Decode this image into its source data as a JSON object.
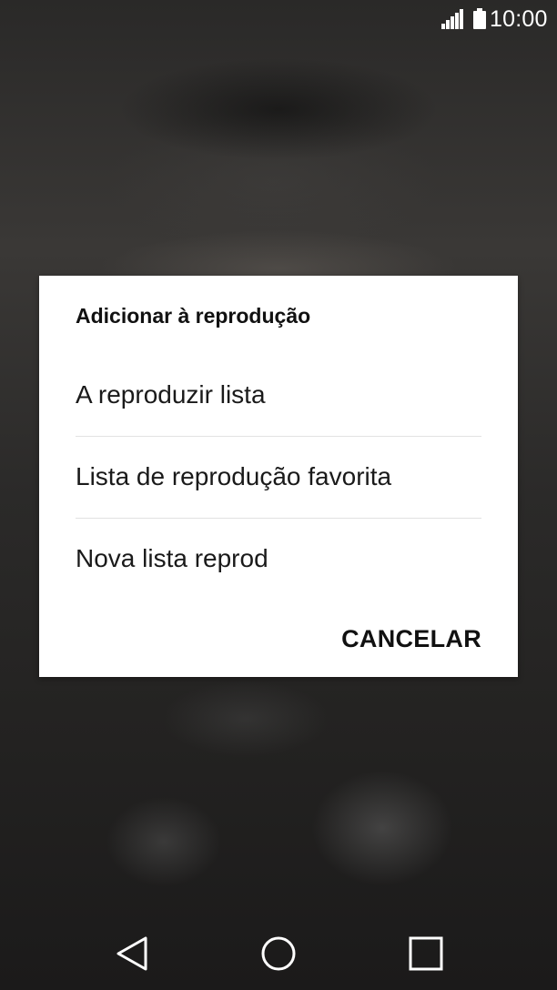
{
  "status_bar": {
    "time": "10:00",
    "signal_icon": "signal-icon",
    "battery_icon": "battery-icon"
  },
  "dialog": {
    "title": "Adicionar à reprodução",
    "options": [
      {
        "label": "A reproduzir lista"
      },
      {
        "label": "Lista de reprodução favorita"
      },
      {
        "label": "Nova lista reprod"
      }
    ],
    "cancel_label": "CANCELAR"
  },
  "nav_bar": {
    "back_icon": "back-icon",
    "home_icon": "home-icon",
    "recents_icon": "recents-icon"
  },
  "colors": {
    "dialog_background": "#ffffff",
    "text": "#111111",
    "divider": "#e2e2e2",
    "status_icons": "#ffffff"
  }
}
